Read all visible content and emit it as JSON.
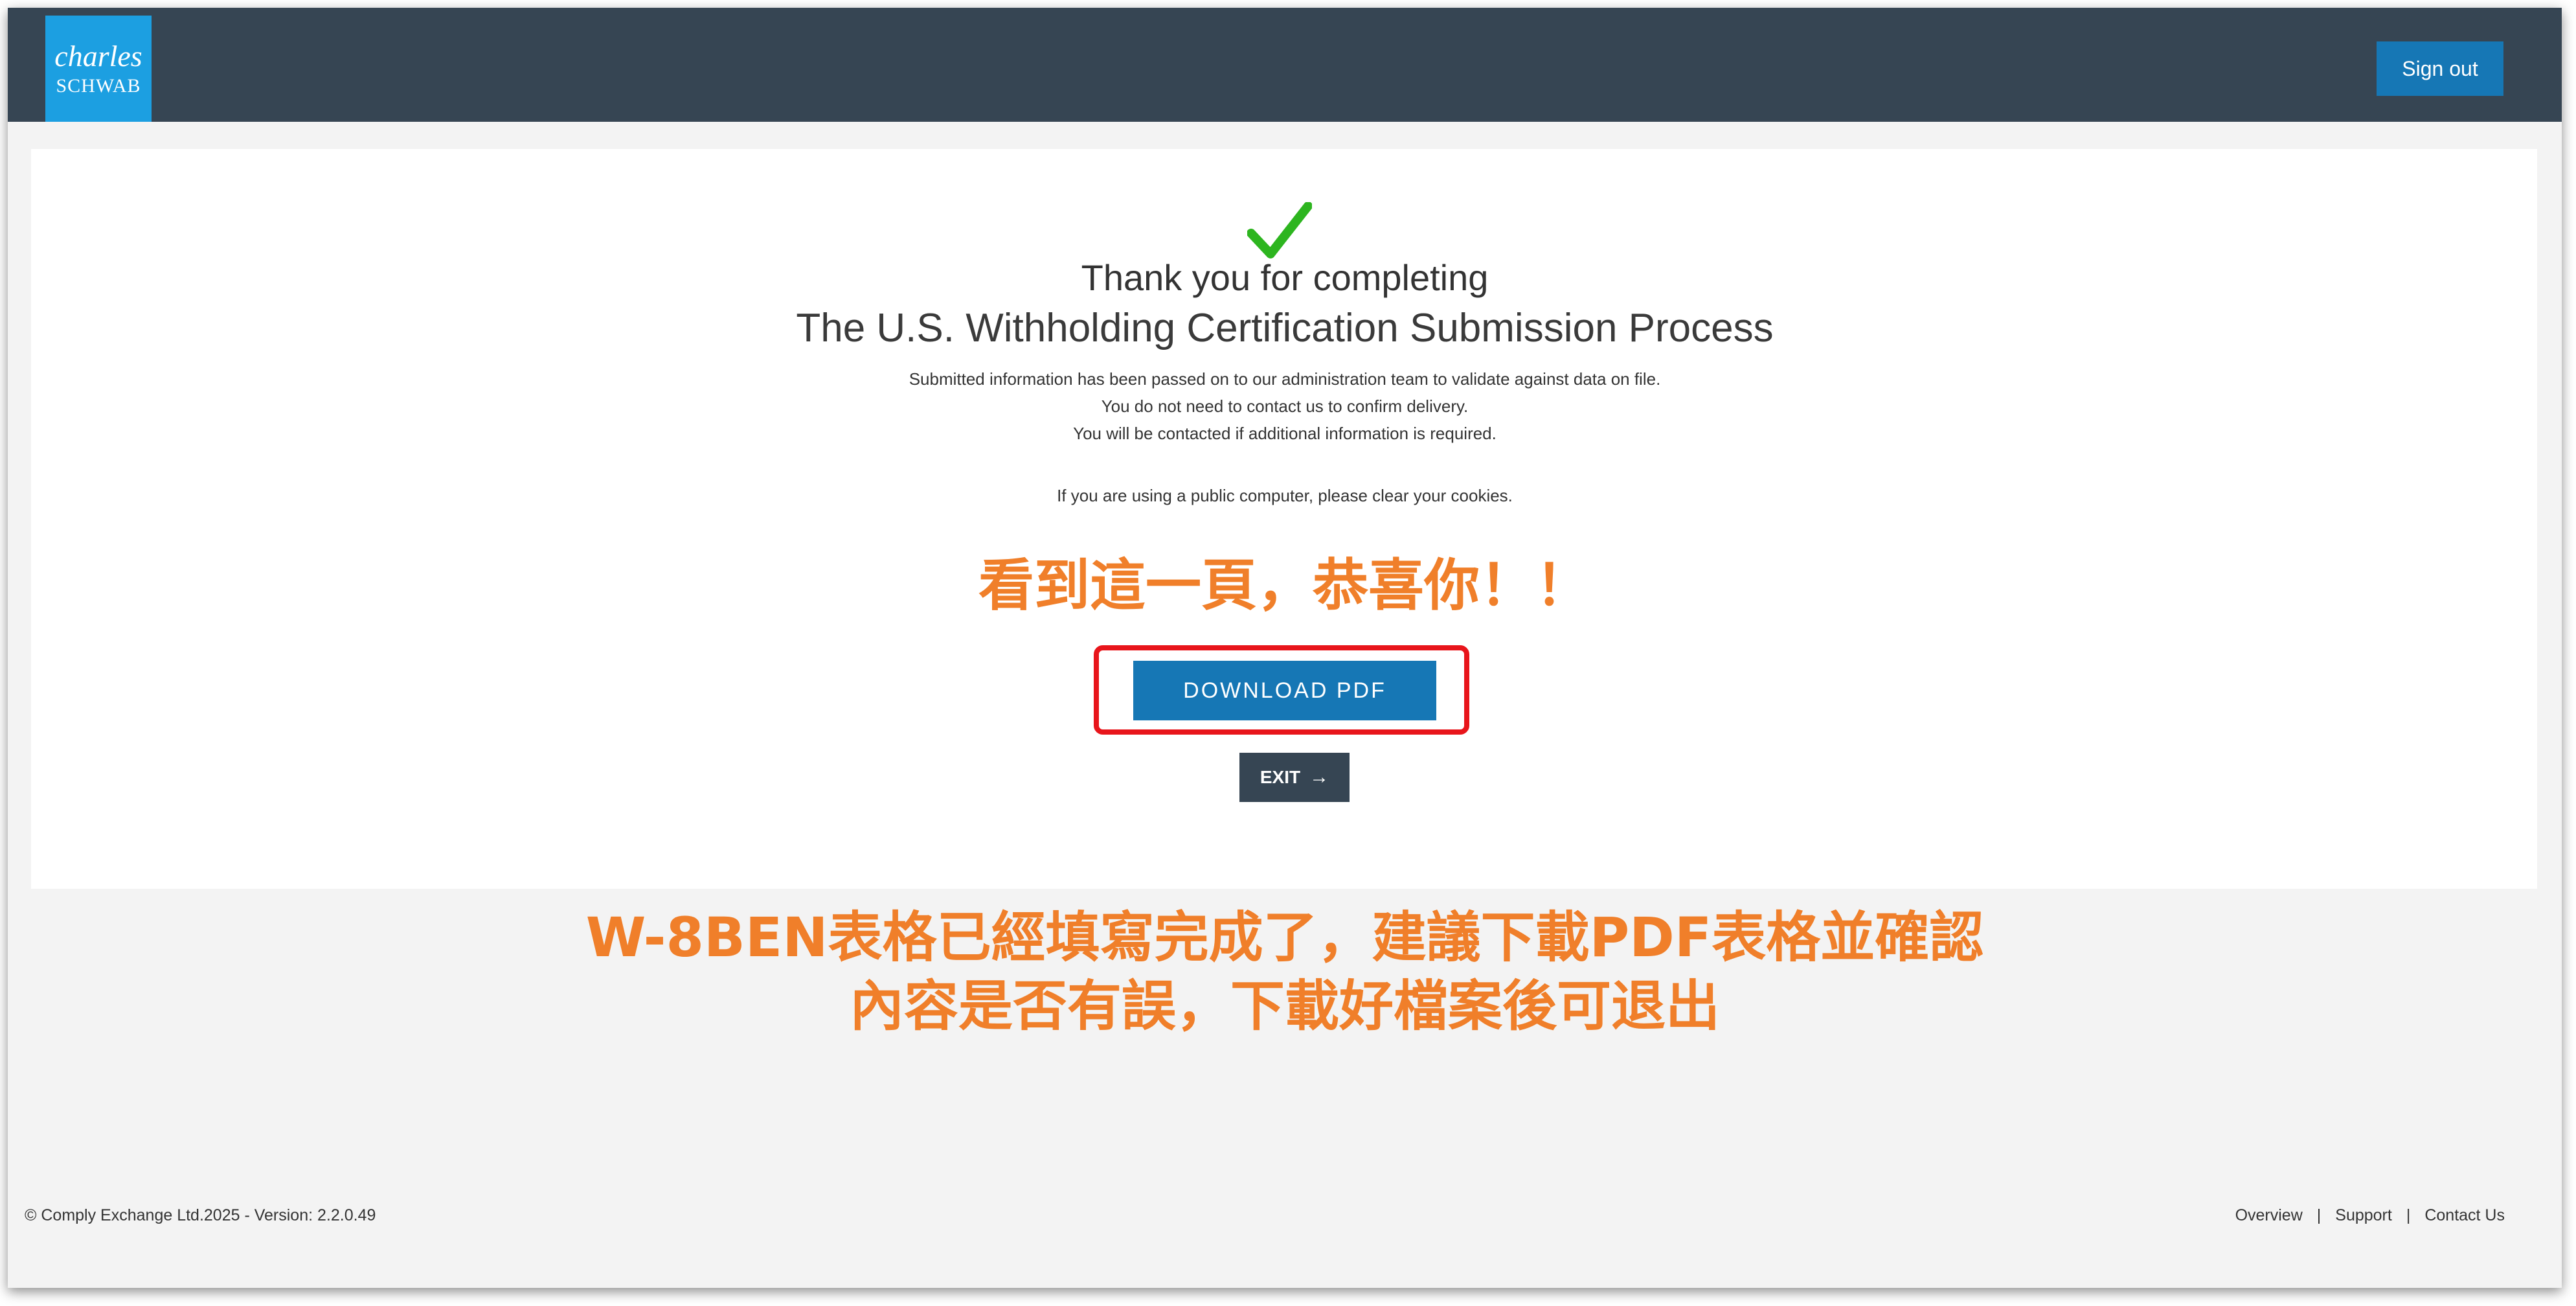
{
  "header": {
    "logo": {
      "line1": "charles",
      "line2": "SCHWAB"
    },
    "sign_out_label": "Sign out"
  },
  "main": {
    "heading_line1": "Thank you for completing",
    "heading_line2": "The U.S. Withholding Certification Submission Process",
    "info_lines": [
      "Submitted information has been passed on to our administration team to validate against data on file.",
      "You do not need to contact us to confirm delivery.",
      "You will be contacted if additional information is required."
    ],
    "cookie_notice": "If you are using a public computer, please clear your cookies.",
    "download_label": "DOWNLOAD PDF",
    "exit_label": "EXIT",
    "exit_arrow": "→"
  },
  "annotations": {
    "congrats": "看到這一頁，恭喜你！！",
    "note_line1": "W-8BEN表格已經填寫完成了，建議下載PDF表格並確認",
    "note_line2": "內容是否有誤，下載好檔案後可退出"
  },
  "footer": {
    "copyright": "© Comply Exchange Ltd.2025 - Version: 2.2.0.49",
    "links": [
      "Overview",
      "Support",
      "Contact Us"
    ],
    "separator": "|"
  },
  "colors": {
    "header_bg": "#364553",
    "logo_bg": "#1c9fe1",
    "primary_button": "#1677b5",
    "check_green": "#2db51f",
    "annotation_orange": "#f07f2a",
    "highlight_red": "#e8151b"
  },
  "icons": {
    "success": "checkmark-icon",
    "exit": "arrow-right-icon"
  }
}
